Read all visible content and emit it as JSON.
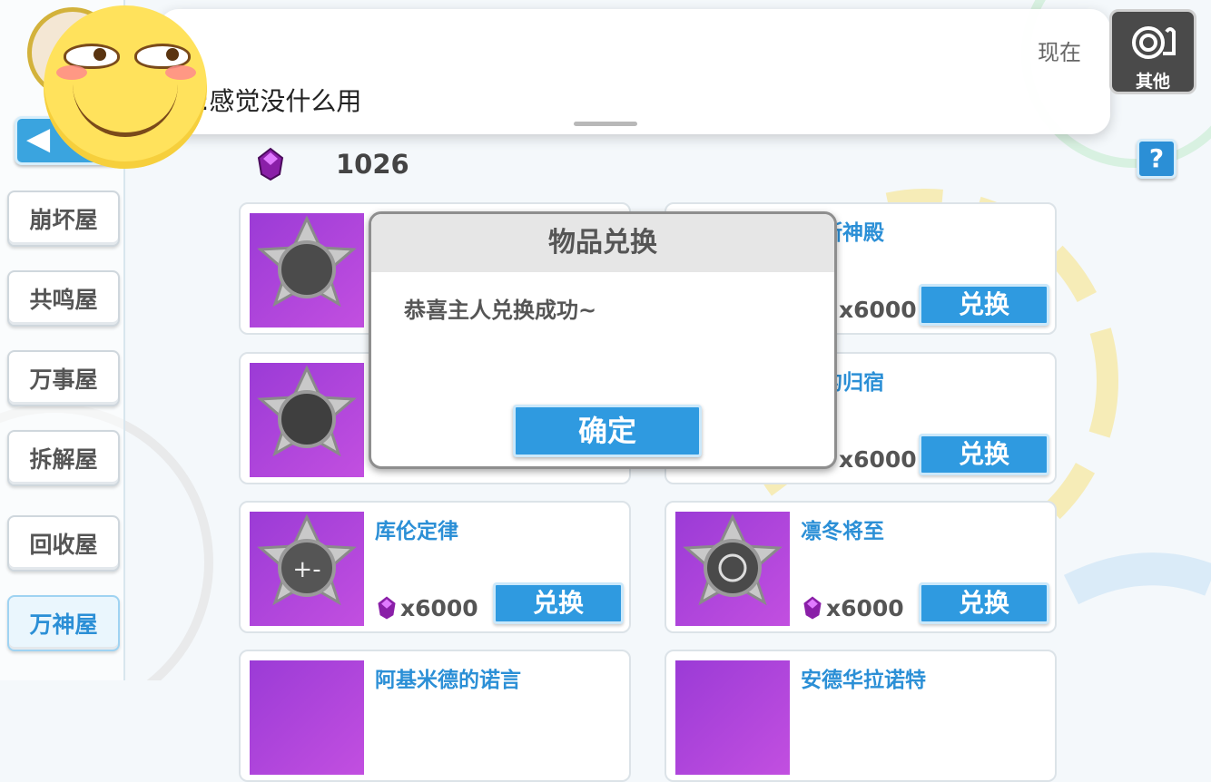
{
  "notification": {
    "message": ":感觉没什么用",
    "time": "现在"
  },
  "other_button": {
    "label": "其他",
    "icon": "snail-shell-icon"
  },
  "help_button": {
    "label": "?"
  },
  "currency": {
    "icon": "purple-gem-icon",
    "value": "1026"
  },
  "sidebar": {
    "items": [
      {
        "label": "崩坏屋",
        "active": false
      },
      {
        "label": "共鸣屋",
        "active": false
      },
      {
        "label": "万事屋",
        "active": false
      },
      {
        "label": "拆解屋",
        "active": false
      },
      {
        "label": "回收屋",
        "active": false
      },
      {
        "label": "万神屋",
        "active": true
      }
    ]
  },
  "cards": [
    {
      "name": "",
      "price": "",
      "button": ""
    },
    {
      "name": "匹斯神殿",
      "price": "x6000",
      "button": "兑换"
    },
    {
      "name": "",
      "price": "",
      "button": ""
    },
    {
      "name": "斯的归宿",
      "price": "x6000",
      "button": "兑换"
    },
    {
      "name": "库伦定律",
      "price": "x6000",
      "button": "兑换"
    },
    {
      "name": "凛冬将至",
      "price": "x6000",
      "button": "兑换"
    },
    {
      "name": "阿基米德的诺言",
      "price": "",
      "button": ""
    },
    {
      "name": "安德华拉诺特",
      "price": "",
      "button": ""
    }
  ],
  "modal": {
    "title": "物品兑换",
    "message": "恭喜主人兑换成功~",
    "confirm": "确定"
  },
  "colors": {
    "accent": "#2f9ae0",
    "gem": "#8a1fa8",
    "badge_bg": "#9b3bd6"
  }
}
